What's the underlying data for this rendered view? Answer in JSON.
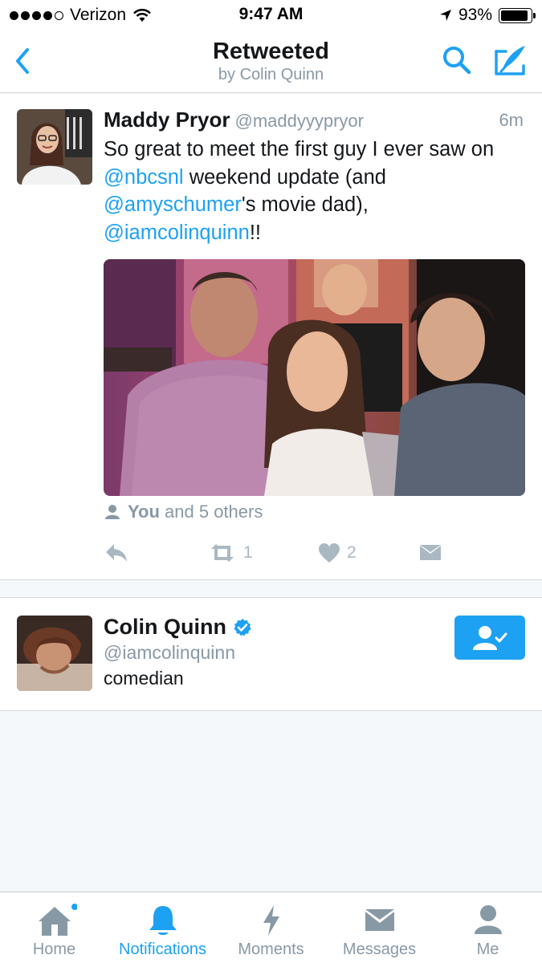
{
  "status_bar": {
    "carrier": "Verizon",
    "time": "9:47 AM",
    "battery": "93%",
    "battery_level": 0.93,
    "signal_bars": 4
  },
  "nav": {
    "title": "Retweeted",
    "subtitle": "by Colin Quinn",
    "back_icon": "chevron-left-icon",
    "search_icon": "search-icon",
    "compose_icon": "compose-icon"
  },
  "tweet": {
    "name": "Maddy Pryor",
    "handle": "@maddyyypryor",
    "time_ago": "6m",
    "text_1": "So great to meet the first guy I ever saw on ",
    "mention_1": "@nbcsnl",
    "text_2": " weekend update (and ",
    "mention_2": "@amyschumer",
    "text_3": "'s movie dad), ",
    "mention_3": "@iamcolinquinn",
    "text_4": "!!",
    "social_you": "You",
    "social_rest": "and 5 others",
    "reply_icon": "reply-icon",
    "retweet_count": "1",
    "like_count": "2",
    "dm_icon": "envelope-icon"
  },
  "user_card": {
    "name": "Colin Quinn",
    "handle": "@iamcolinquinn",
    "bio": "comedian",
    "verified_icon": "verified-badge-icon",
    "follow_state": "following"
  },
  "tabs": [
    {
      "label": "Home",
      "icon": "home-icon",
      "active": false,
      "badge": true
    },
    {
      "label": "Notifications",
      "icon": "bell-icon",
      "active": true
    },
    {
      "label": "Moments",
      "icon": "lightning-icon",
      "active": false
    },
    {
      "label": "Messages",
      "icon": "envelope-icon",
      "active": false
    },
    {
      "label": "Me",
      "icon": "person-icon",
      "active": false
    }
  ],
  "colors": {
    "accent": "#1da1f2",
    "text": "#14171a",
    "muted": "#8899a6",
    "icon_gray": "#aab8c2",
    "background": "#f5f8fa"
  }
}
